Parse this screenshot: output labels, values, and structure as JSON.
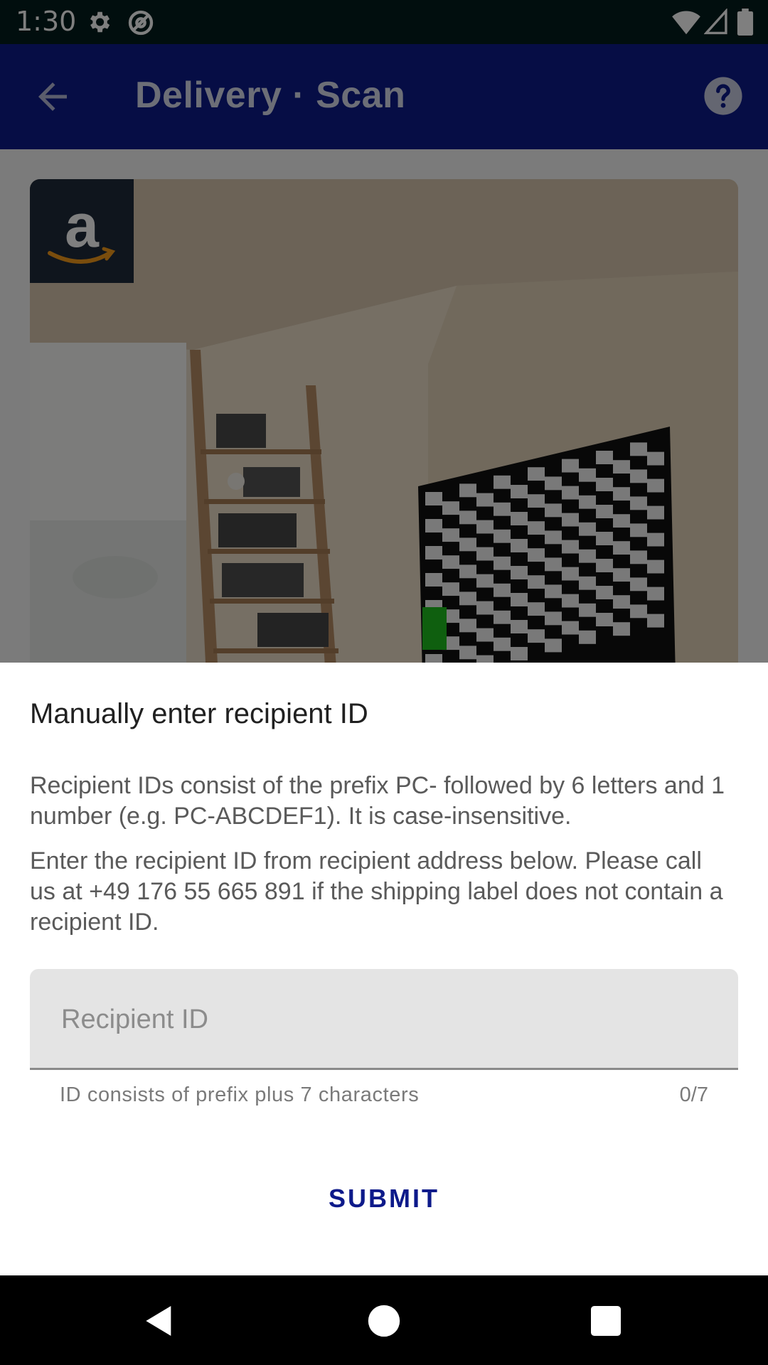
{
  "status_bar": {
    "time": "1:30",
    "left_icons": [
      "gear-icon",
      "at-sign-icon"
    ],
    "right_icons": [
      "wifi-icon",
      "signal-icon",
      "battery-icon"
    ]
  },
  "app_bar": {
    "title": "Delivery · Scan",
    "background": "#0d1a8a"
  },
  "sheet": {
    "title": "Manually enter recipient ID",
    "description": "Recipient IDs consist of the prefix PC- followed by 6 letters and 1 number (e.g. PC-ABCDEF1). It is case-insensitive.",
    "instruction": "Enter the recipient ID from recipient address below. Please call us at +49 176 55 665 891 if the shipping label does not contain a recipient ID.",
    "input": {
      "placeholder": "Recipient ID",
      "value": "",
      "helper": "ID consists of prefix plus 7 characters",
      "counter": "0/7"
    },
    "submit_label": "SUBMIT"
  },
  "colors": {
    "accent": "#0d1a8a",
    "scrim": "rgba(0,0,0,0.5)"
  }
}
